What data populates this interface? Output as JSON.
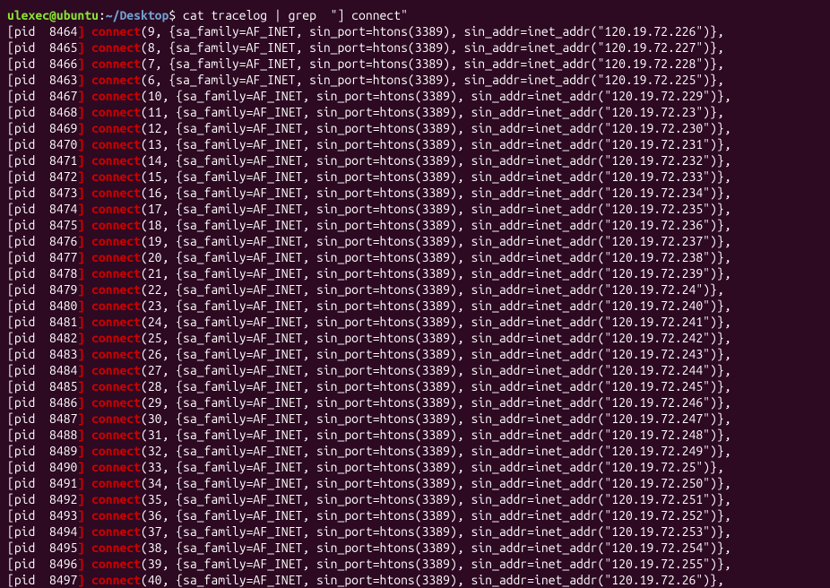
{
  "prompt": {
    "user": "ulexec",
    "host": "ubuntu",
    "path": "~/Desktop",
    "command": "cat tracelog | grep  \"] connect\""
  },
  "lines": [
    {
      "pid": "8464",
      "fd": "9",
      "port": "3389",
      "addr": "120.19.72.226"
    },
    {
      "pid": "8465",
      "fd": "8",
      "port": "3389",
      "addr": "120.19.72.227"
    },
    {
      "pid": "8466",
      "fd": "7",
      "port": "3389",
      "addr": "120.19.72.228"
    },
    {
      "pid": "8463",
      "fd": "6",
      "port": "3389",
      "addr": "120.19.72.225"
    },
    {
      "pid": "8467",
      "fd": "10",
      "port": "3389",
      "addr": "120.19.72.229"
    },
    {
      "pid": "8468",
      "fd": "11",
      "port": "3389",
      "addr": "120.19.72.23"
    },
    {
      "pid": "8469",
      "fd": "12",
      "port": "3389",
      "addr": "120.19.72.230"
    },
    {
      "pid": "8470",
      "fd": "13",
      "port": "3389",
      "addr": "120.19.72.231"
    },
    {
      "pid": "8471",
      "fd": "14",
      "port": "3389",
      "addr": "120.19.72.232"
    },
    {
      "pid": "8472",
      "fd": "15",
      "port": "3389",
      "addr": "120.19.72.233"
    },
    {
      "pid": "8473",
      "fd": "16",
      "port": "3389",
      "addr": "120.19.72.234"
    },
    {
      "pid": "8474",
      "fd": "17",
      "port": "3389",
      "addr": "120.19.72.235"
    },
    {
      "pid": "8475",
      "fd": "18",
      "port": "3389",
      "addr": "120.19.72.236"
    },
    {
      "pid": "8476",
      "fd": "19",
      "port": "3389",
      "addr": "120.19.72.237"
    },
    {
      "pid": "8477",
      "fd": "20",
      "port": "3389",
      "addr": "120.19.72.238"
    },
    {
      "pid": "8478",
      "fd": "21",
      "port": "3389",
      "addr": "120.19.72.239"
    },
    {
      "pid": "8479",
      "fd": "22",
      "port": "3389",
      "addr": "120.19.72.24"
    },
    {
      "pid": "8480",
      "fd": "23",
      "port": "3389",
      "addr": "120.19.72.240"
    },
    {
      "pid": "8481",
      "fd": "24",
      "port": "3389",
      "addr": "120.19.72.241"
    },
    {
      "pid": "8482",
      "fd": "25",
      "port": "3389",
      "addr": "120.19.72.242"
    },
    {
      "pid": "8483",
      "fd": "26",
      "port": "3389",
      "addr": "120.19.72.243"
    },
    {
      "pid": "8484",
      "fd": "27",
      "port": "3389",
      "addr": "120.19.72.244"
    },
    {
      "pid": "8485",
      "fd": "28",
      "port": "3389",
      "addr": "120.19.72.245"
    },
    {
      "pid": "8486",
      "fd": "29",
      "port": "3389",
      "addr": "120.19.72.246"
    },
    {
      "pid": "8487",
      "fd": "30",
      "port": "3389",
      "addr": "120.19.72.247"
    },
    {
      "pid": "8488",
      "fd": "31",
      "port": "3389",
      "addr": "120.19.72.248"
    },
    {
      "pid": "8489",
      "fd": "32",
      "port": "3389",
      "addr": "120.19.72.249"
    },
    {
      "pid": "8490",
      "fd": "33",
      "port": "3389",
      "addr": "120.19.72.25"
    },
    {
      "pid": "8491",
      "fd": "34",
      "port": "3389",
      "addr": "120.19.72.250"
    },
    {
      "pid": "8492",
      "fd": "35",
      "port": "3389",
      "addr": "120.19.72.251"
    },
    {
      "pid": "8493",
      "fd": "36",
      "port": "3389",
      "addr": "120.19.72.252"
    },
    {
      "pid": "8494",
      "fd": "37",
      "port": "3389",
      "addr": "120.19.72.253"
    },
    {
      "pid": "8495",
      "fd": "38",
      "port": "3389",
      "addr": "120.19.72.254"
    },
    {
      "pid": "8496",
      "fd": "39",
      "port": "3389",
      "addr": "120.19.72.255"
    },
    {
      "pid": "8497",
      "fd": "40",
      "port": "3389",
      "addr": "120.19.72.26"
    }
  ]
}
